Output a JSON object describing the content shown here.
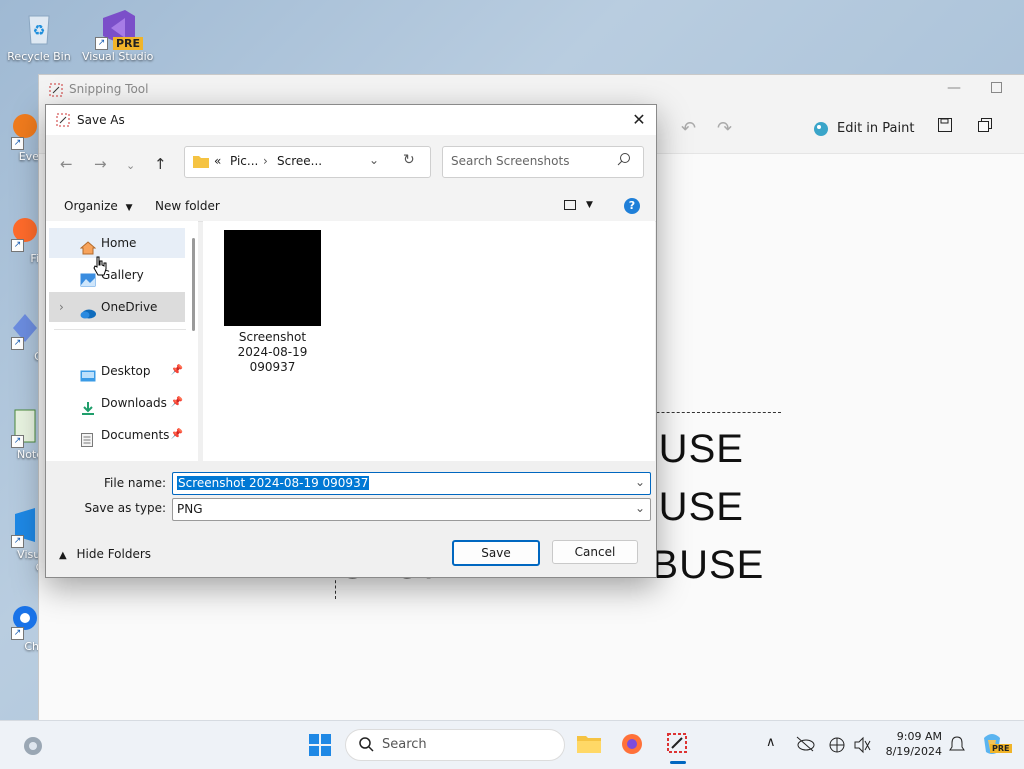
{
  "desktop": {
    "icons": [
      {
        "label": "Recycle Bin"
      },
      {
        "label": "Visual Studio"
      },
      {
        "label": "Every"
      },
      {
        "label": "Fire"
      },
      {
        "label": "Git"
      },
      {
        "label": "Notep"
      },
      {
        "label": "Visual"
      },
      {
        "label": "Co"
      },
      {
        "label": "Chro"
      }
    ],
    "vs_badge": "PRE"
  },
  "snipping_tool": {
    "title": "Snipping Tool",
    "edit_in_paint": "Edit in Paint",
    "canvas_lines": [
      "BUSE",
      "BUSE",
      "BUSE"
    ],
    "canvas_bottom_text": "STOP ANIMAL ABUSE"
  },
  "dialog": {
    "title": "Save As",
    "breadcrumb": {
      "prefix": "«",
      "segment1": "Pic...",
      "segment2": "Scree..."
    },
    "search_placeholder": "Search Screenshots",
    "organize": "Organize",
    "new_folder": "New folder",
    "nav_items": [
      {
        "label": "Home"
      },
      {
        "label": "Gallery"
      },
      {
        "label": "OneDrive"
      },
      {
        "label": "Desktop"
      },
      {
        "label": "Downloads"
      },
      {
        "label": "Documents"
      }
    ],
    "file": {
      "name_line1": "Screenshot",
      "name_line2": "2024-08-19",
      "name_line3": "090937"
    },
    "file_name_label": "File name:",
    "file_name_value": "Screenshot 2024-08-19 090937",
    "save_type_label": "Save as type:",
    "save_type_value": "PNG",
    "hide_folders": "Hide Folders",
    "save_button": "Save",
    "cancel_button": "Cancel"
  },
  "taskbar": {
    "search_placeholder": "Search",
    "time": "9:09 AM",
    "date": "8/19/2024",
    "copilot_badge": "PRE"
  },
  "colors": {
    "accent": "#0067c0",
    "selection": "#0078d4",
    "onedrive_blue": "#0f6cbd"
  }
}
